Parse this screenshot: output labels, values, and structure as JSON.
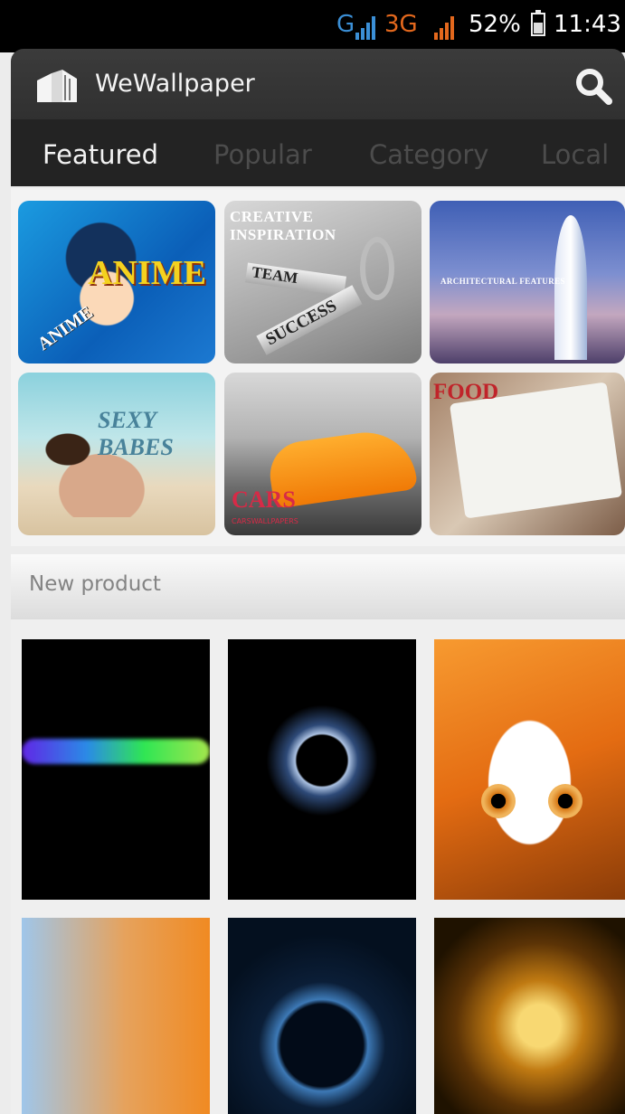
{
  "status_bar": {
    "network_1": "G",
    "network_2": "3G",
    "battery": "52%",
    "time": "11:43"
  },
  "header": {
    "app_title": "WeWallpaper",
    "search_icon": "search-icon",
    "logo_icon": "book-logo-icon"
  },
  "tabs": [
    {
      "label": "Featured",
      "active": true
    },
    {
      "label": "Popular",
      "active": false
    },
    {
      "label": "Category",
      "active": false
    },
    {
      "label": "Local",
      "active": false
    }
  ],
  "featured": [
    {
      "caption": "ANIME",
      "caption2": "ANIME"
    },
    {
      "caption": "CREATIVE INSPIRATION",
      "caption2": "TEAM",
      "caption3": "SUCCESS"
    },
    {
      "caption": "ARCHITECTURAL FEATURES"
    },
    {
      "caption": "SEXY BABES"
    },
    {
      "caption": "CARS",
      "caption2": "CARSWALLPAPERS"
    },
    {
      "caption": "FOOD"
    }
  ],
  "new_product": {
    "label": "New product"
  },
  "colors": {
    "header_bg": "#2f2f2f",
    "tab_active": "#f2f2f2",
    "tab_inactive": "#4c4c4c",
    "network_blue": "#3b8fd6",
    "network_orange": "#e3681d"
  }
}
